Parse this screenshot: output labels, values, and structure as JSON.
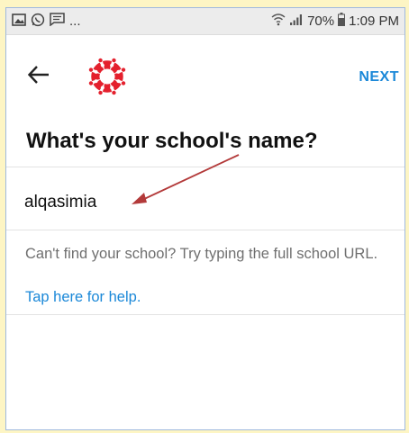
{
  "status_bar": {
    "left_icons": [
      "image-icon",
      "whatsapp-icon",
      "message-icon"
    ],
    "ellipsis": "...",
    "battery": "70%",
    "time": "1:09 PM"
  },
  "header": {
    "next_label": "NEXT",
    "brand_color": "#e4202d"
  },
  "main": {
    "title": "What's your school's name?",
    "school_input": {
      "value": "alqasimia",
      "placeholder": ""
    },
    "help_text": "Can't find your school? Try typing the full school URL.",
    "help_link": "Tap here for help."
  },
  "colors": {
    "accent": "#1b88d8",
    "annotation_arrow": "#b33a3a",
    "page_background": "#fdf5c4"
  }
}
